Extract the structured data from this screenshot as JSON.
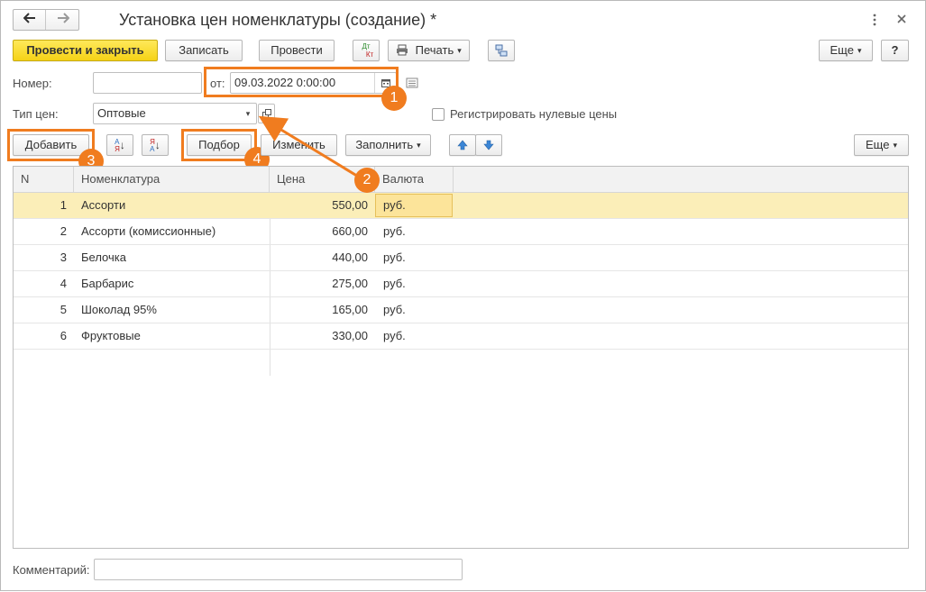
{
  "window": {
    "title": "Установка цен номенклатуры (создание) *"
  },
  "toolbar": {
    "post_close": "Провести и закрыть",
    "save": "Записать",
    "post": "Провести",
    "dtkt_top": "Дт",
    "dtkt_bottom": "Кт",
    "print": "Печать",
    "more": "Еще",
    "help": "?"
  },
  "form": {
    "number_label": "Номер:",
    "number_value": "",
    "date_label": "от:",
    "date_value": "09.03.2022  0:00:00",
    "price_type_label": "Тип цен:",
    "price_type_value": "Оптовые",
    "zero_prices_label": "Регистрировать нулевые цены",
    "comment_label": "Комментарий:",
    "comment_value": ""
  },
  "table_toolbar": {
    "add": "Добавить",
    "pick": "Подбор",
    "edit": "Изменить",
    "fill": "Заполнить",
    "more": "Еще",
    "sort_asc_top": "А",
    "sort_asc_bottom": "Я",
    "sort_desc_top": "Я",
    "sort_desc_bottom": "А"
  },
  "table": {
    "columns": [
      "N",
      "Номенклатура",
      "Цена",
      "Валюта"
    ],
    "rows": [
      {
        "n": "1",
        "name": "Ассорти",
        "price": "550,00",
        "currency": "руб."
      },
      {
        "n": "2",
        "name": "Ассорти (комиссионные)",
        "price": "660,00",
        "currency": "руб."
      },
      {
        "n": "3",
        "name": "Белочка",
        "price": "440,00",
        "currency": "руб."
      },
      {
        "n": "4",
        "name": "Барбарис",
        "price": "275,00",
        "currency": "руб."
      },
      {
        "n": "5",
        "name": "Шоколад 95%",
        "price": "165,00",
        "currency": "руб."
      },
      {
        "n": "6",
        "name": "Фруктовые",
        "price": "330,00",
        "currency": "руб."
      }
    ]
  },
  "callouts": {
    "one": "1",
    "two": "2",
    "three": "3",
    "four": "4"
  },
  "colors": {
    "accent_orange": "#f07c1f",
    "primary_yellow": "#f5d216",
    "selected_row": "#fbeeb8"
  },
  "icons": [
    "back-arrow-icon",
    "forward-arrow-icon",
    "kebab-menu-icon",
    "close-icon",
    "printer-icon",
    "structure-icon",
    "calendar-icon",
    "open-form-icon",
    "dropdown-icon",
    "arrow-up-icon",
    "arrow-down-icon",
    "sort-asc-icon",
    "sort-desc-icon",
    "list-icon"
  ]
}
